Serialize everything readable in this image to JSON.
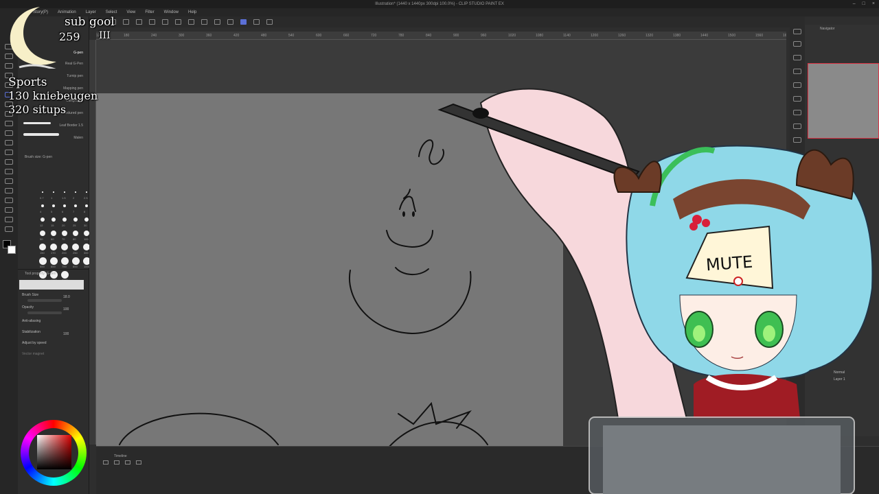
{
  "window": {
    "title": "Illustration* (1440 x 1440px 300dpi 100.0%) - CLIP STUDIO PAINT EX"
  },
  "menu": {
    "items": [
      "Story(P)",
      "Animation",
      "Layer",
      "Select",
      "View",
      "Filter",
      "Window",
      "Help"
    ]
  },
  "ruler": {
    "ticks": [
      "120",
      "180",
      "240",
      "300",
      "360",
      "420",
      "480",
      "540",
      "600",
      "660",
      "720",
      "780",
      "840",
      "900",
      "960",
      "1020",
      "1080",
      "1140",
      "1200",
      "1260",
      "1320",
      "1380",
      "1440",
      "1500",
      "1560",
      "1620",
      "1680",
      "1740"
    ]
  },
  "sub_tool_panel": {
    "brushes": [
      "G-pen",
      "Real G-Pen",
      "Turnip pen",
      "Mapping pen",
      "Calligraphy",
      "Textured pen",
      "Leaf Border 1.5",
      "Malen"
    ],
    "brush_size_header": "Brush size: G-pen",
    "size_labels": [
      "0.7",
      "1",
      "1.5",
      "2",
      "2.5",
      "3",
      "4",
      "5",
      "6",
      "7",
      "8",
      "10",
      "12",
      "15",
      "20",
      "25",
      "30",
      "40",
      "50",
      "60",
      "70",
      "80",
      "100",
      "120",
      "150",
      "170",
      "200",
      "250",
      "300",
      "400",
      "500",
      "600",
      "700",
      "800",
      "1000",
      "1200",
      "1500",
      "1700",
      "2000"
    ]
  },
  "tool_property": {
    "header": "Tool property: G-pen",
    "brush_size_label": "Brush Size",
    "brush_size_value": "18.0",
    "opacity_label": "Opacity",
    "opacity_value": "100",
    "antialiasing_label": "Anti-aliasing",
    "stabilization_label": "Stabilization",
    "stabilization_value": "100",
    "adjust_label": "Adjust by speed",
    "vector_label": "Vector magnet"
  },
  "timeline": {
    "label": "Timeline"
  },
  "navigator": {
    "label": "Navigator"
  },
  "layer": {
    "mode": "Normal",
    "name": "Layer 1"
  },
  "overlay": {
    "sub_goal_label": "sub gool",
    "sub_goal_value": "259",
    "sub_goal_marks": "III",
    "sports_label": "Sports",
    "line1": "130 kniebeugen",
    "line2": "320 situps",
    "mute_sign": "MUTE"
  },
  "colors": {
    "accent": "#5b6fd6",
    "canvas": "#777777",
    "panel": "#2d2d2d"
  }
}
